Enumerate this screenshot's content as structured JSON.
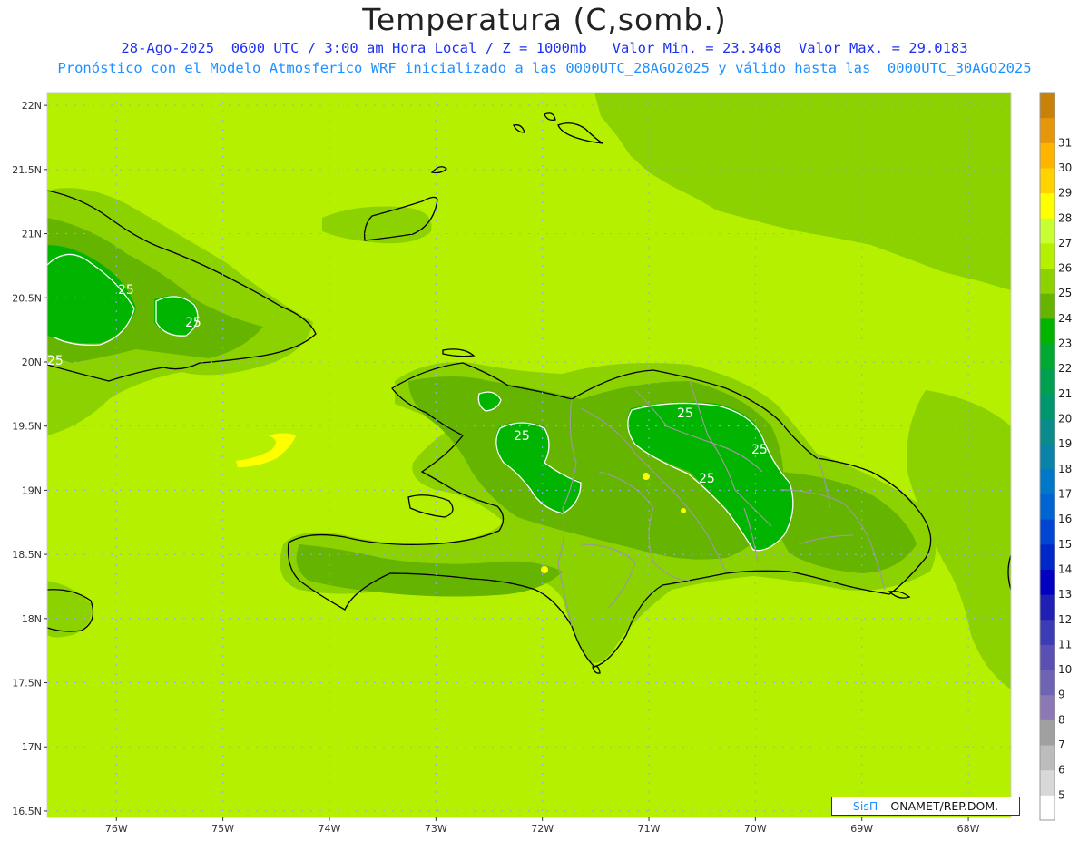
{
  "title": "Temperatura (C,somb.)",
  "subtitle_line1": "28-Ago-2025  0600 UTC / 3:00 am Hora Local / Z = 1000mb   Valor Min. = 23.3468  Valor Max. = 29.0183",
  "subtitle_line2": "Pronóstico con el Modelo Atmosferico WRF inicializado a las 0000UTC_28AGO2025 y válido hasta las  0000UTC_30AGO2025",
  "credit": {
    "brand": "SisΠ",
    "text": " – ONAMET/REP.DOM."
  },
  "chart_data": {
    "type": "heatmap",
    "variable": "Temperatura",
    "units": "C",
    "level": "1000mb",
    "valid_time": "28-Ago-2025 0600 UTC",
    "value_min": 23.3468,
    "value_max": 29.0183,
    "lon_ticks": [
      "76W",
      "75W",
      "74W",
      "73W",
      "72W",
      "71W",
      "70W",
      "69W",
      "68W"
    ],
    "lat_ticks": [
      "22N",
      "21.5N",
      "21N",
      "20.5N",
      "20N",
      "19.5N",
      "19N",
      "18.5N",
      "18N",
      "17.5N",
      "17N",
      "16.5N"
    ],
    "lon_range": [
      -76.65,
      -67.6
    ],
    "lat_range": [
      16.45,
      22.1
    ],
    "contour_labels": [
      "25",
      "25",
      "25",
      "25",
      "25",
      "25",
      "25",
      "25"
    ],
    "colorbar_values": [
      5,
      6,
      7,
      8,
      9,
      10,
      11,
      12,
      13,
      14,
      15,
      16,
      17,
      18,
      19,
      20,
      21,
      22,
      23,
      24,
      25,
      26,
      27,
      28,
      29,
      30,
      31
    ],
    "colorbar_labels": [
      "5",
      "6",
      "7",
      "8",
      "9",
      "10",
      "11",
      "12",
      "13",
      "14",
      "15",
      "16",
      "17",
      "18",
      "19",
      "20",
      "21",
      "22",
      "23",
      "24",
      "25",
      "26",
      "27",
      "28",
      "29",
      "30",
      "31"
    ],
    "colorbar_colors": [
      "#ffffff",
      "#d8d8d8",
      "#bcbcbc",
      "#a0a0a0",
      "#8c78b4",
      "#6e64b4",
      "#5a50b4",
      "#3c3cb4",
      "#2020b4",
      "#0000c0",
      "#0028c8",
      "#0046d2",
      "#0064d2",
      "#0078c8",
      "#0a82aa",
      "#0a8c8c",
      "#00966e",
      "#00a050",
      "#00aa32",
      "#00b400",
      "#64b400",
      "#8cd200",
      "#b4f000",
      "#c8ff32",
      "#ffff00",
      "#ffd200",
      "#ffb400",
      "#e6960a",
      "#c8820a"
    ]
  }
}
